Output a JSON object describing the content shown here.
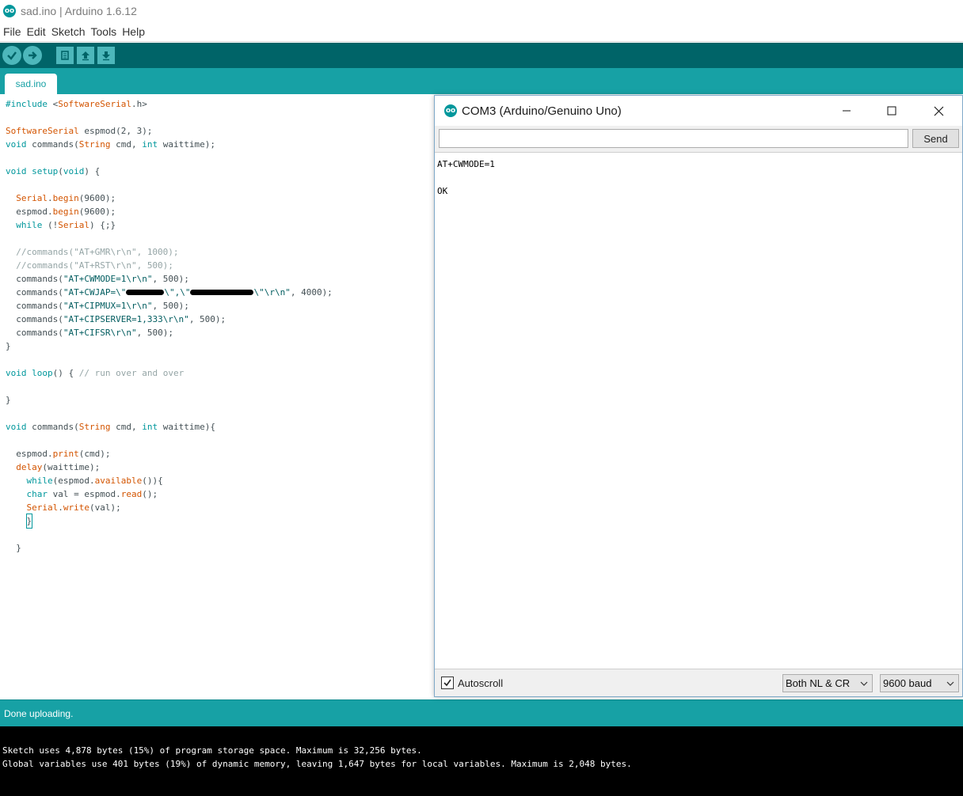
{
  "window": {
    "title": "sad.ino | Arduino 1.6.12",
    "logo_glyph": "oo"
  },
  "menu": {
    "items": [
      "File",
      "Edit",
      "Sketch",
      "Tools",
      "Help"
    ]
  },
  "toolbar": {
    "icons": [
      "verify-icon",
      "upload-icon",
      "new-icon",
      "open-icon",
      "save-icon"
    ],
    "colors": {
      "bar": "#006468",
      "button": "#4db7bb"
    }
  },
  "tabs": [
    {
      "label": "sad.ino",
      "active": true
    }
  ],
  "editor": {
    "lines": [
      [
        [
          "kw",
          "#include "
        ],
        [
          "",
          "<"
        ],
        [
          "ty",
          "SoftwareSerial"
        ],
        [
          "",
          ".h>"
        ]
      ],
      [],
      [
        [
          "ty",
          "SoftwareSerial"
        ],
        [
          "",
          " espmod(2, 3);"
        ]
      ],
      [
        [
          "kw",
          "void"
        ],
        [
          "",
          " commands("
        ],
        [
          "ty",
          "String"
        ],
        [
          "",
          " cmd, "
        ],
        [
          "kw",
          "int"
        ],
        [
          "",
          " waittime);"
        ]
      ],
      [],
      [
        [
          "kw",
          "void"
        ],
        [
          "",
          " "
        ],
        [
          "kw",
          "setup"
        ],
        [
          "",
          "("
        ],
        [
          "kw",
          "void"
        ],
        [
          "",
          ") {"
        ]
      ],
      [],
      [
        [
          "",
          "  "
        ],
        [
          "ty",
          "Serial"
        ],
        [
          "",
          "."
        ],
        [
          "ty",
          "begin"
        ],
        [
          "",
          "(9600);"
        ]
      ],
      [
        [
          "",
          "  espmod."
        ],
        [
          "ty",
          "begin"
        ],
        [
          "",
          "(9600);"
        ]
      ],
      [
        [
          "",
          "  "
        ],
        [
          "kw",
          "while"
        ],
        [
          "",
          " (!"
        ],
        [
          "ty",
          "Serial"
        ],
        [
          "",
          ") {;}"
        ]
      ],
      [],
      [
        [
          "",
          "  "
        ],
        [
          "cm",
          "//commands(\"AT+GMR\\r\\n\", 1000);"
        ]
      ],
      [
        [
          "",
          "  "
        ],
        [
          "cm",
          "//commands(\"AT+RST\\r\\n\", 500);"
        ]
      ],
      [
        [
          "",
          "  commands("
        ],
        [
          "st",
          "\"AT+CWMODE=1\\r\\n\""
        ],
        [
          "",
          ", 500);"
        ]
      ],
      [
        [
          "",
          "  commands("
        ],
        [
          "st",
          "\"AT+CWJAP=\\\""
        ],
        [
          "redact",
          "48"
        ],
        [
          "st",
          "\\\",\\\""
        ],
        [
          "redact",
          "80"
        ],
        [
          "st",
          "\\\"\\r\\n\""
        ],
        [
          "",
          ", 4000);"
        ]
      ],
      [
        [
          "",
          "  commands("
        ],
        [
          "st",
          "\"AT+CIPMUX=1\\r\\n\""
        ],
        [
          "",
          ", 500);"
        ]
      ],
      [
        [
          "",
          "  commands("
        ],
        [
          "st",
          "\"AT+CIPSERVER=1,333\\r\\n\""
        ],
        [
          "",
          ", 500);"
        ]
      ],
      [
        [
          "",
          "  commands("
        ],
        [
          "st",
          "\"AT+CIFSR\\r\\n\""
        ],
        [
          "",
          ", 500);"
        ]
      ],
      [
        [
          "",
          "}"
        ]
      ],
      [],
      [
        [
          "kw",
          "void"
        ],
        [
          "",
          " "
        ],
        [
          "kw",
          "loop"
        ],
        [
          "",
          "() { "
        ],
        [
          "cm",
          "// run over and over"
        ]
      ],
      [],
      [
        [
          "",
          "}"
        ]
      ],
      [],
      [
        [
          "kw",
          "void"
        ],
        [
          "",
          " commands("
        ],
        [
          "ty",
          "String"
        ],
        [
          "",
          " cmd, "
        ],
        [
          "kw",
          "int"
        ],
        [
          "",
          " waittime){"
        ]
      ],
      [],
      [
        [
          "",
          "  espmod."
        ],
        [
          "ty",
          "print"
        ],
        [
          "",
          "(cmd);"
        ]
      ],
      [
        [
          "",
          "  "
        ],
        [
          "ty",
          "delay"
        ],
        [
          "",
          "(waittime);"
        ]
      ],
      [
        [
          "",
          "    "
        ],
        [
          "kw",
          "while"
        ],
        [
          "",
          "(espmod."
        ],
        [
          "ty",
          "available"
        ],
        [
          "",
          "()){"
        ]
      ],
      [
        [
          "",
          "    "
        ],
        [
          "kw",
          "char"
        ],
        [
          "",
          " val = espmod."
        ],
        [
          "ty",
          "read"
        ],
        [
          "",
          "();"
        ]
      ],
      [
        [
          "",
          "    "
        ],
        [
          "ty",
          "Serial"
        ],
        [
          "",
          "."
        ],
        [
          "ty",
          "write"
        ],
        [
          "",
          "(val);"
        ]
      ],
      [
        [
          "",
          "    "
        ],
        [
          "cursor",
          "}"
        ]
      ],
      [],
      [
        [
          "",
          "  }"
        ]
      ]
    ]
  },
  "status": {
    "text": "Done uploading."
  },
  "console": {
    "lines": [
      "Sketch uses 4,878 bytes (15%) of program storage space. Maximum is 32,256 bytes.",
      "Global variables use 401 bytes (19%) of dynamic memory, leaving 1,647 bytes for local variables. Maximum is 2,048 bytes."
    ]
  },
  "serial_monitor": {
    "title": "COM3 (Arduino/Genuino Uno)",
    "input_value": "",
    "send_label": "Send",
    "output": "AT+CWMODE=1\n\nOK",
    "autoscroll": {
      "label": "Autoscroll",
      "checked": true
    },
    "line_ending": "Both NL & CR",
    "baud": "9600 baud"
  }
}
